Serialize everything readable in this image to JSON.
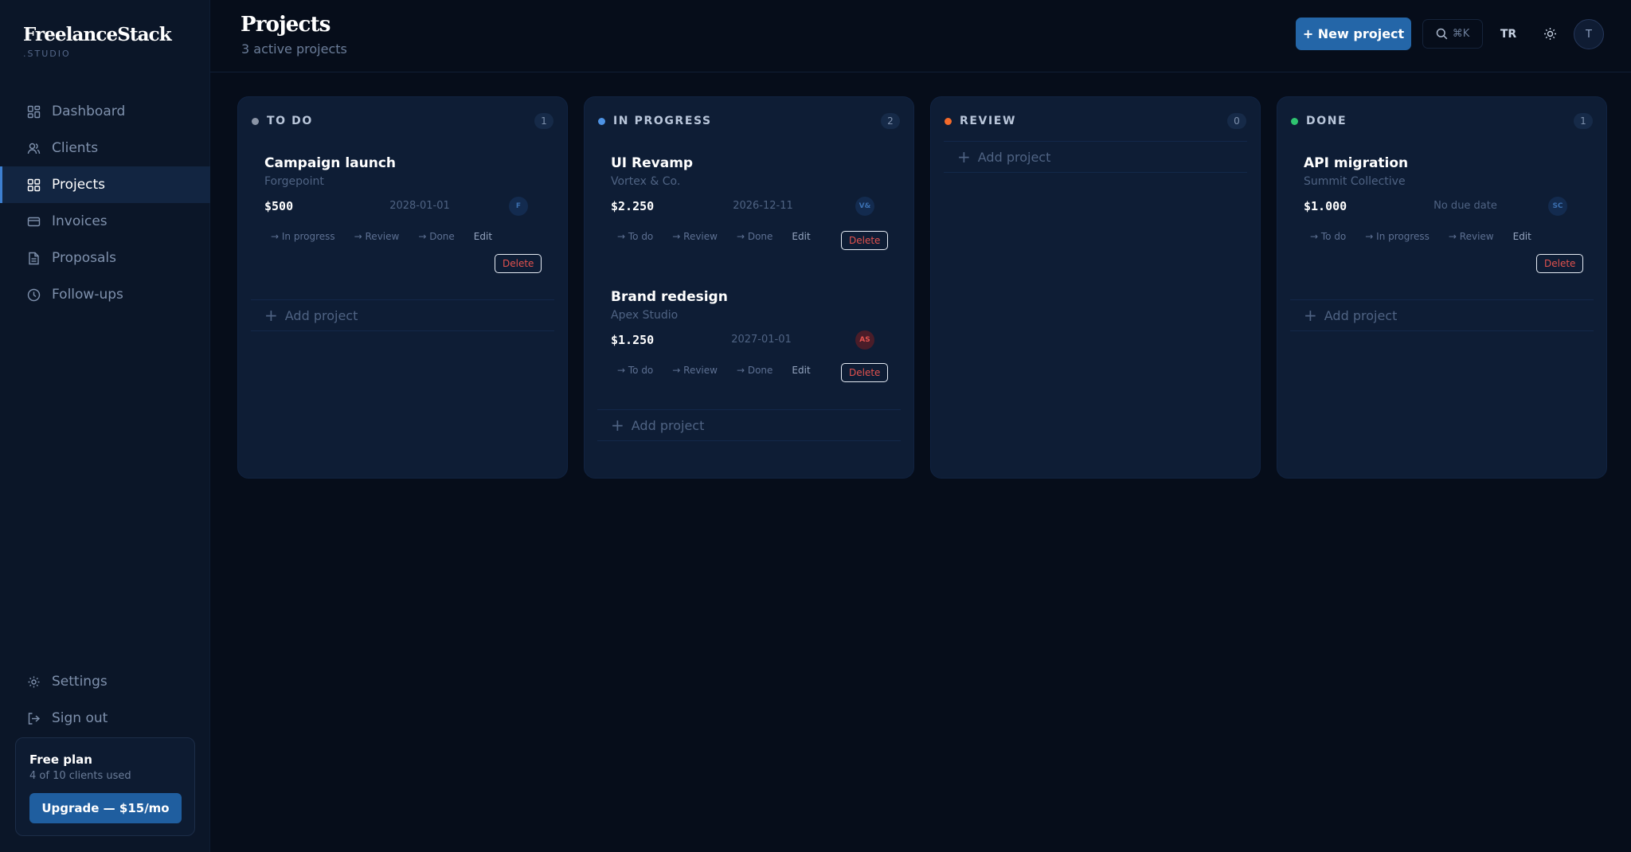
{
  "brand": {
    "name": "FreelanceStack",
    "sub": ".STUDIO"
  },
  "nav": {
    "items": [
      {
        "label": "Dashboard",
        "icon": "dashboard-icon"
      },
      {
        "label": "Clients",
        "icon": "users-icon"
      },
      {
        "label": "Projects",
        "icon": "grid-icon",
        "active": true
      },
      {
        "label": "Invoices",
        "icon": "card-icon"
      },
      {
        "label": "Proposals",
        "icon": "document-icon"
      },
      {
        "label": "Follow-ups",
        "icon": "clock-icon"
      }
    ],
    "bottom": [
      {
        "label": "Settings",
        "icon": "gear-icon"
      },
      {
        "label": "Sign out",
        "icon": "sign-out-icon"
      }
    ]
  },
  "plan": {
    "title": "Free plan",
    "sub": "4 of 10 clients used",
    "upgrade_label": "Upgrade — $15/mo"
  },
  "header": {
    "title": "Projects",
    "subtitle": "3 active projects",
    "new_label": "+ New project",
    "search_shortcut": "⌘K",
    "lang": "TR",
    "avatar": "T"
  },
  "colors": {
    "accent": "#2466a8",
    "todo": "#8a94a6",
    "in_progress": "#4e93e4",
    "review": "#f46a2a",
    "done": "#2fc470",
    "delete": "#e2524e"
  },
  "board": {
    "add_label": "Add project",
    "columns": [
      {
        "title": "TO DO",
        "count": "1",
        "dot": "#8a94a6",
        "cards": [
          {
            "title": "Campaign launch",
            "client": "Forgepoint",
            "amount": "$500",
            "date": "2028-01-01",
            "avatar": "F",
            "moves": [
              "→ In progress",
              "→ Review",
              "→ Done"
            ],
            "edit": "Edit",
            "delete": "Delete"
          }
        ]
      },
      {
        "title": "IN PROGRESS",
        "count": "2",
        "dot": "#4e93e4",
        "cards": [
          {
            "title": "UI Revamp",
            "client": "Vortex & Co.",
            "amount": "$2.250",
            "date": "2026-12-11",
            "avatar": "V&",
            "moves": [
              "→ To do",
              "→ Review",
              "→ Done"
            ],
            "edit": "Edit",
            "delete": "Delete"
          },
          {
            "title": "Brand redesign",
            "client": "Apex Studio",
            "amount": "$1.250",
            "date": "2027-01-01",
            "avatar": "AS",
            "moves": [
              "→ To do",
              "→ Review",
              "→ Done"
            ],
            "edit": "Edit",
            "delete": "Delete"
          }
        ]
      },
      {
        "title": "REVIEW",
        "count": "0",
        "dot": "#f46a2a",
        "cards": []
      },
      {
        "title": "DONE",
        "count": "1",
        "dot": "#2fc470",
        "cards": [
          {
            "title": "API migration",
            "client": "Summit Collective",
            "amount": "$1.000",
            "date": "No due date",
            "avatar": "SC",
            "moves": [
              "→ To do",
              "→ In progress",
              "→ Review"
            ],
            "edit": "Edit",
            "delete": "Delete"
          }
        ]
      }
    ]
  }
}
